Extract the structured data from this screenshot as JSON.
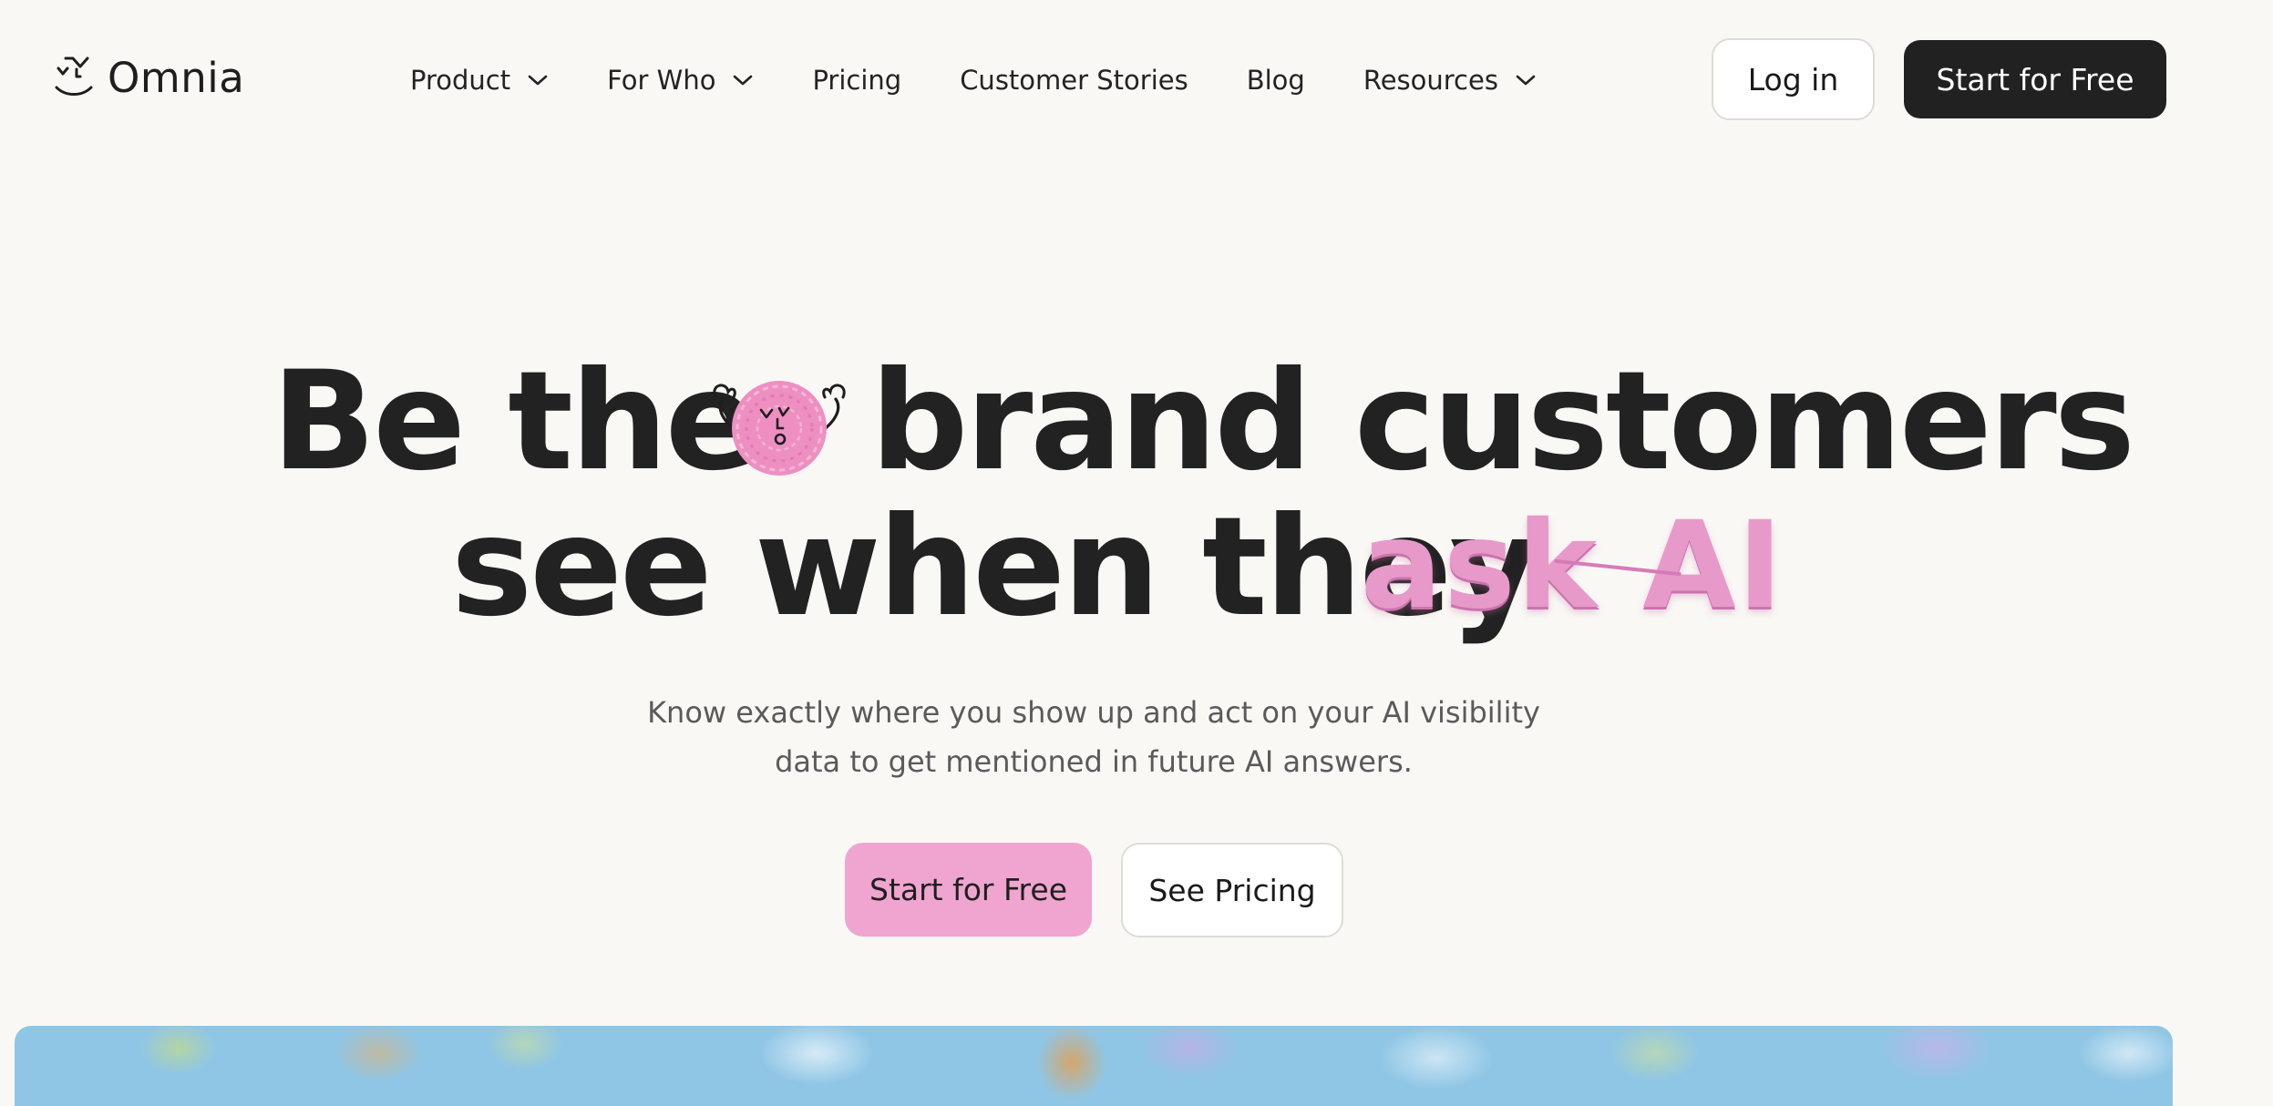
{
  "brand": {
    "name": "Omnia"
  },
  "nav": {
    "items": [
      {
        "label": "Product",
        "has_dropdown": true
      },
      {
        "label": "For Who",
        "has_dropdown": true
      },
      {
        "label": "Pricing",
        "has_dropdown": false
      },
      {
        "label": "Customer Stories",
        "has_dropdown": false
      },
      {
        "label": "Blog",
        "has_dropdown": false
      },
      {
        "label": "Resources",
        "has_dropdown": true
      }
    ],
    "login_label": "Log in",
    "start_label": "Start for Free"
  },
  "hero": {
    "line1_start": "Be the",
    "line1_end": "brand customers",
    "line2": "see when they",
    "accent": "ask AI",
    "subtitle_line1": "Know exactly where you show up and act on your AI visibility",
    "subtitle_line2": "data to get mentioned in future AI answers.",
    "primary_cta": "Start for Free",
    "secondary_cta": "See Pricing"
  },
  "icons": {
    "logo": "omnia-face-logo-icon",
    "dropdown": "chevron-down-icon",
    "mascot": "pink-yarn-ball-mascot-icon"
  },
  "colors": {
    "background": "#f9f8f5",
    "text": "#222222",
    "dark_button": "#212121",
    "pink_accent": "#f0a5d0",
    "ask_ai": "#e79ac9",
    "banner_sky": "#8fc6e5"
  }
}
